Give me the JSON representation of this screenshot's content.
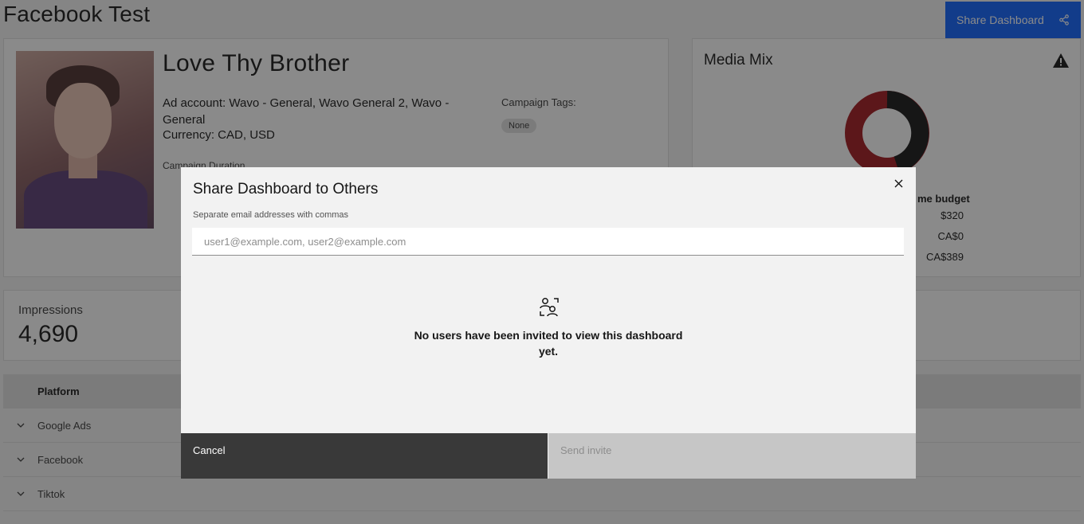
{
  "page": {
    "title": "Facebook Test"
  },
  "header": {
    "share_label": "Share Dashboard",
    "share_icon": "share-icon"
  },
  "campaign": {
    "name": "Love Thy Brother",
    "ad_account": "Ad account: Wavo - General, Wavo General 2, Wavo - General",
    "currency": "Currency: CAD, USD",
    "duration_label": "Campaign Duration",
    "tags_label": "Campaign Tags:",
    "tag": "None"
  },
  "media_mix": {
    "title": "Media Mix",
    "budget_header": "me budget",
    "budgets": [
      "$320",
      "CA$0",
      "CA$389"
    ],
    "colors": {
      "black": "#161616",
      "red": "#a2191f"
    }
  },
  "impressions": {
    "label": "Impressions",
    "value": "4,690"
  },
  "table": {
    "header": "Platform",
    "rows": [
      "Google Ads",
      "Facebook",
      "Tiktok"
    ]
  },
  "modal": {
    "title": "Share Dashboard to Others",
    "email_label": "Separate email addresses with commas",
    "email_placeholder": "user1@example.com, user2@example.com",
    "email_value": "",
    "empty_message": "No users have been invited to view this dashboard yet.",
    "cancel_label": "Cancel",
    "send_label": "Send invite"
  },
  "colors": {
    "primary": "#0f62fe",
    "overlay": "rgba(22,22,22,0.5)"
  }
}
